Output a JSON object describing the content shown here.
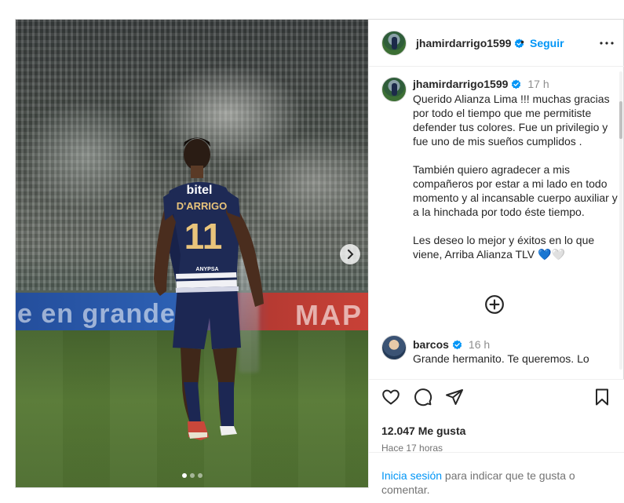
{
  "post": {
    "username": "jhamirdarrigo1599",
    "separator": "•",
    "follow_label": "Seguir",
    "caption_time": "17 h",
    "caption": "Querido Alianza Lima !!! muchas gracias por todo el tiempo que me permitiste defender tus colores. Fue un privilegio y fue uno de mis sueños cumplidos .\n\nTambién quiero agradecer a mis compañeros por estar a mi lado en todo momento y al incansable cuerpo auxiliar y a la hinchada por todo éste tiempo.\n\nLes deseo lo mejor y éxitos en lo que viene, Arriba Alianza TLV 💙🤍",
    "media": {
      "board_text_left": "e en grande",
      "board_text_right": "MAP",
      "jersey_sponsor": "bitel",
      "jersey_name": "D'ARRIGO",
      "jersey_number": "11",
      "shorts_sponsor": "ANYPSA",
      "carousel_count": 3,
      "carousel_active": 1
    }
  },
  "comment": {
    "username": "barcos",
    "time": "16 h",
    "text": "Grande hermanito. Te queremos. Lo"
  },
  "engagement": {
    "likes": "12.047 Me gusta",
    "posted": "Hace 17 horas",
    "login_link": "Inicia sesión",
    "login_rest": " para indicar que te gusta o comentar."
  },
  "icons": {
    "verified": "verified-badge-icon",
    "more": "more-options-icon",
    "like": "heart-icon",
    "comment": "comment-icon",
    "share": "share-icon",
    "save": "bookmark-icon",
    "load_more": "plus-circle-icon",
    "next": "chevron-right-icon"
  },
  "colors": {
    "accent": "#0095f6",
    "verified": "#0095f6",
    "text": "#262626",
    "muted": "#737373"
  }
}
